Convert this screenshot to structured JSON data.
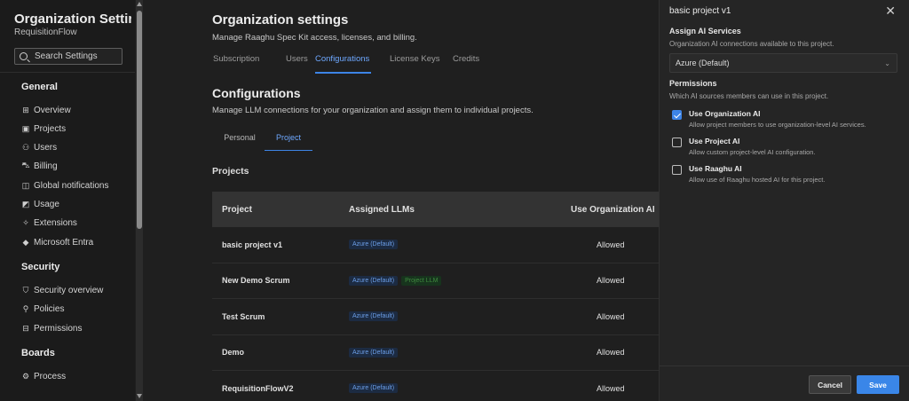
{
  "sidebar": {
    "title": "Organization Settin...",
    "subtitle": "RequisitionFlow",
    "search_placeholder": "Search Settings",
    "sections": {
      "general": {
        "label": "General",
        "items": [
          {
            "label": "Overview",
            "icon": "overview-grid-icon"
          },
          {
            "label": "Projects",
            "icon": "projects-icon"
          },
          {
            "label": "Users",
            "icon": "users-icon"
          },
          {
            "label": "Billing",
            "icon": "billing-cart-icon"
          },
          {
            "label": "Global notifications",
            "icon": "notifications-icon"
          },
          {
            "label": "Usage",
            "icon": "usage-icon"
          },
          {
            "label": "Extensions",
            "icon": "extensions-icon"
          },
          {
            "label": "Microsoft Entra",
            "icon": "entra-icon"
          }
        ]
      },
      "security": {
        "label": "Security",
        "items": [
          {
            "label": "Security overview",
            "icon": "shield-icon"
          },
          {
            "label": "Policies",
            "icon": "policy-icon"
          },
          {
            "label": "Permissions",
            "icon": "lock-icon"
          }
        ]
      },
      "boards": {
        "label": "Boards",
        "items": [
          {
            "label": "Process",
            "icon": "process-icon"
          }
        ]
      }
    }
  },
  "header": {
    "title": "Organization settings",
    "subtitle": "Manage Raaghu Spec Kit access, licenses, and billing.",
    "tabs": [
      "Subscription",
      "Users",
      "Configurations",
      "License Keys",
      "Credits"
    ],
    "active_tab": "Configurations"
  },
  "configurations": {
    "title": "Configurations",
    "subtitle": "Manage LLM connections for your organization and assign them to individual projects.",
    "subtabs": [
      "Personal",
      "Project"
    ],
    "active_subtab": "Project",
    "projects_label": "Projects",
    "columns": [
      "Project",
      "Assigned LLMs",
      "Use Organization AI"
    ],
    "rows": [
      {
        "project": "basic project v1",
        "llms": [
          "Azure (Default)"
        ],
        "use_org_ai": "Allowed"
      },
      {
        "project": "New Demo Scrum",
        "llms": [
          "Azure (Default)",
          "Project LLM"
        ],
        "use_org_ai": "Allowed"
      },
      {
        "project": "Test Scrum",
        "llms": [
          "Azure (Default)"
        ],
        "use_org_ai": "Allowed"
      },
      {
        "project": "Demo",
        "llms": [
          "Azure (Default)"
        ],
        "use_org_ai": "Allowed"
      },
      {
        "project": "RequisitionFlowV2",
        "llms": [
          "Azure (Default)"
        ],
        "use_org_ai": "Allowed"
      }
    ]
  },
  "panel": {
    "title": "basic project v1",
    "assign_heading": "Assign AI Services",
    "assign_desc": "Organization AI connections available to this project.",
    "selected_service": "Azure (Default)",
    "permissions_heading": "Permissions",
    "permissions_desc": "Which AI sources members can use in this project.",
    "options": [
      {
        "title": "Use Organization AI",
        "desc": "Allow project members to use organization-level AI services.",
        "checked": true
      },
      {
        "title": "Use Project AI",
        "desc": "Allow custom project-level AI configuration.",
        "checked": false
      },
      {
        "title": "Use Raaghu AI",
        "desc": "Allow use of Raaghu hosted AI for this project.",
        "checked": false
      }
    ],
    "cancel_label": "Cancel",
    "save_label": "Save"
  },
  "colors": {
    "accent": "#3d84e6",
    "background": "#1f1f1f",
    "panel": "#252525",
    "table_header": "#333333"
  }
}
